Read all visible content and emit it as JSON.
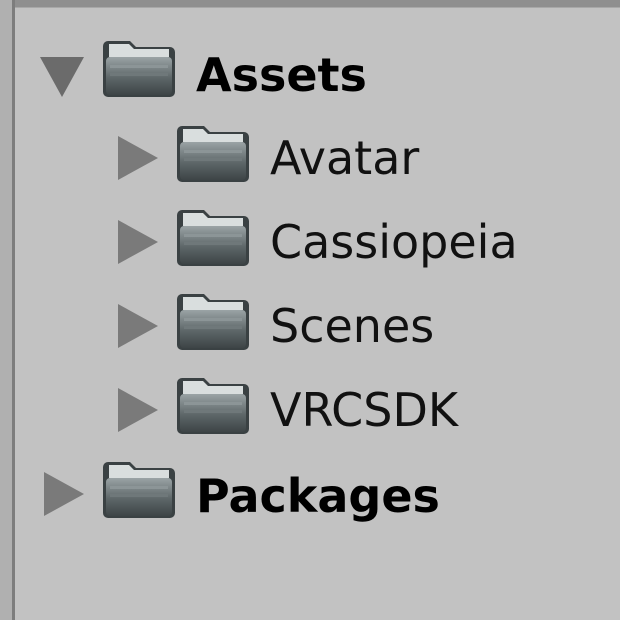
{
  "project": {
    "root_items": [
      {
        "label": "Assets",
        "expanded": true,
        "icon": "folder-icon",
        "children": [
          {
            "label": "Avatar",
            "icon": "folder-icon"
          },
          {
            "label": "Cassiopeia",
            "icon": "folder-icon"
          },
          {
            "label": "Scenes",
            "icon": "folder-icon"
          },
          {
            "label": "VRCSDK",
            "icon": "folder-icon"
          }
        ]
      },
      {
        "label": "Packages",
        "expanded": false,
        "icon": "folder-icon"
      }
    ]
  }
}
